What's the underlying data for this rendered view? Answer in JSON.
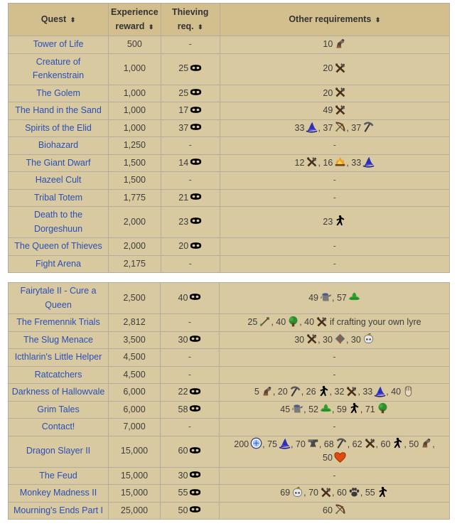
{
  "headers": {
    "quest": "Quest",
    "experience": "Experience reward",
    "thieving": "Thieving req.",
    "other": "Other requirements",
    "sort_glyph": "⬍"
  },
  "dash": "-",
  "tables": [
    {
      "rows": [
        {
          "quest": "Tower of Life",
          "xp": "500",
          "thieving": null,
          "other": [
            {
              "level": "10",
              "skill": "construction"
            }
          ]
        },
        {
          "quest": "Creature of Fenkenstrain",
          "xp": "1,000",
          "thieving": "25",
          "other": [
            {
              "level": "20",
              "skill": "crafting"
            }
          ]
        },
        {
          "quest": "The Golem",
          "xp": "1,000",
          "thieving": "25",
          "other": [
            {
              "level": "20",
              "skill": "crafting"
            }
          ]
        },
        {
          "quest": "The Hand in the Sand",
          "xp": "1,000",
          "thieving": "17",
          "other": [
            {
              "level": "49",
              "skill": "crafting"
            }
          ]
        },
        {
          "quest": "Spirits of the Elid",
          "xp": "1,000",
          "thieving": "37",
          "other": [
            {
              "level": "33",
              "skill": "magic"
            },
            {
              "level": "37",
              "skill": "ranged"
            },
            {
              "level": "37",
              "skill": "mining"
            }
          ]
        },
        {
          "quest": "Biohazard",
          "xp": "1,250",
          "thieving": null,
          "other": []
        },
        {
          "quest": "The Giant Dwarf",
          "xp": "1,500",
          "thieving": "14",
          "other": [
            {
              "level": "12",
              "skill": "crafting"
            },
            {
              "level": "16",
              "skill": "firemaking"
            },
            {
              "level": "33",
              "skill": "magic"
            }
          ]
        },
        {
          "quest": "Hazeel Cult",
          "xp": "1,500",
          "thieving": null,
          "other": []
        },
        {
          "quest": "Tribal Totem",
          "xp": "1,775",
          "thieving": "21",
          "other": []
        },
        {
          "quest": "Death to the Dorgeshuun",
          "xp": "2,000",
          "thieving": "23",
          "other": [
            {
              "level": "23",
              "skill": "agility"
            }
          ]
        },
        {
          "quest": "The Queen of Thieves",
          "xp": "2,000",
          "thieving": "20",
          "other": []
        },
        {
          "quest": "Fight Arena",
          "xp": "2,175",
          "thieving": null,
          "other": []
        }
      ]
    },
    {
      "rows": [
        {
          "quest": "Fairytale II - Cure a Queen",
          "xp": "2,500",
          "thieving": "40",
          "other": [
            {
              "level": "49",
              "skill": "farming"
            },
            {
              "level": "57",
              "skill": "herblore"
            }
          ]
        },
        {
          "quest": "The Fremennik Trials",
          "xp": "2,812",
          "thieving": null,
          "other": [
            {
              "level": "25",
              "skill": "fletching"
            },
            {
              "level": "40",
              "skill": "woodcutting"
            },
            {
              "level": "40",
              "skill": "crafting"
            }
          ],
          "note": "if crafting your own lyre"
        },
        {
          "quest": "The Slug Menace",
          "xp": "3,500",
          "thieving": "30",
          "other": [
            {
              "level": "30",
              "skill": "crafting"
            },
            {
              "level": "30",
              "skill": "runecraft"
            },
            {
              "level": "30",
              "skill": "slayer"
            }
          ]
        },
        {
          "quest": "Icthlarin's Little Helper",
          "xp": "4,500",
          "thieving": null,
          "other": []
        },
        {
          "quest": "Ratcatchers",
          "xp": "4,500",
          "thieving": null,
          "other": []
        },
        {
          "quest": "Darkness of Hallowvale",
          "xp": "6,000",
          "thieving": "22",
          "other": [
            {
              "level": "5",
              "skill": "construction"
            },
            {
              "level": "20",
              "skill": "mining"
            },
            {
              "level": "26",
              "skill": "agility"
            },
            {
              "level": "32",
              "skill": "crafting"
            },
            {
              "level": "33",
              "skill": "magic"
            },
            {
              "level": "40",
              "skill": "strength"
            }
          ]
        },
        {
          "quest": "Grim Tales",
          "xp": "6,000",
          "thieving": "58",
          "other": [
            {
              "level": "45",
              "skill": "farming"
            },
            {
              "level": "52",
              "skill": "herblore"
            },
            {
              "level": "59",
              "skill": "agility"
            },
            {
              "level": "71",
              "skill": "woodcutting"
            }
          ]
        },
        {
          "quest": "Contact!",
          "xp": "7,000",
          "thieving": null,
          "other": []
        },
        {
          "quest": "Dragon Slayer II",
          "xp": "15,000",
          "thieving": "60",
          "other": [
            {
              "level": "200",
              "skill": "quest-points"
            },
            {
              "level": "75",
              "skill": "magic"
            },
            {
              "level": "70",
              "skill": "smithing"
            },
            {
              "level": "68",
              "skill": "mining"
            },
            {
              "level": "62",
              "skill": "crafting"
            },
            {
              "level": "60",
              "skill": "agility"
            },
            {
              "level": "50",
              "skill": "construction"
            },
            {
              "level": "50",
              "skill": "hitpoints"
            }
          ]
        },
        {
          "quest": "The Feud",
          "xp": "15,000",
          "thieving": "30",
          "other": []
        },
        {
          "quest": "Monkey Madness II",
          "xp": "15,000",
          "thieving": "55",
          "other": [
            {
              "level": "69",
              "skill": "slayer"
            },
            {
              "level": "70",
              "skill": "crafting"
            },
            {
              "level": "60",
              "skill": "hunter"
            },
            {
              "level": "55",
              "skill": "agility"
            }
          ]
        },
        {
          "quest": "Mourning's Ends Part I",
          "xp": "25,000",
          "thieving": "50",
          "other": [
            {
              "level": "60",
              "skill": "ranged"
            }
          ]
        }
      ]
    }
  ],
  "colors": {
    "table_bg": "#d8c9a0",
    "header_bg": "#d2bf8d",
    "link": "#2a50b8",
    "border": "#b3ad9f"
  }
}
